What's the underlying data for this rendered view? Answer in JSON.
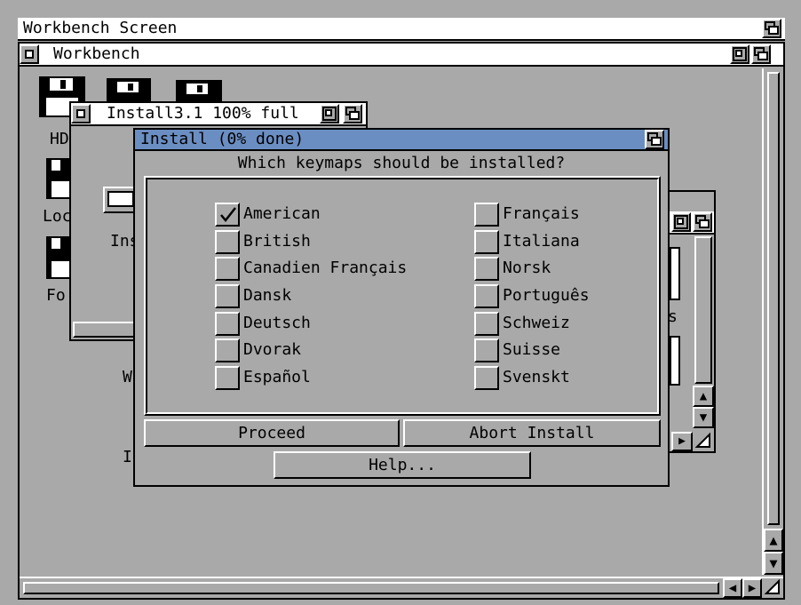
{
  "screen": {
    "title": "Workbench Screen"
  },
  "workbench_window": {
    "title": "Workbench"
  },
  "desktop_icons": [
    "HD",
    "Loc",
    "Fo"
  ],
  "drawer_window": {
    "title": "Install3.1  100% full",
    "icon_label": "Ins"
  },
  "partial_labels": {
    "w": "W",
    "i": "I",
    "s": "s"
  },
  "install_dialog": {
    "title": "Install (0% done)",
    "question": "Which keymaps should be installed?",
    "options_left": [
      {
        "label": "American",
        "checked": true
      },
      {
        "label": "British",
        "checked": false
      },
      {
        "label": "Canadien Français",
        "checked": false
      },
      {
        "label": "Dansk",
        "checked": false
      },
      {
        "label": "Deutsch",
        "checked": false
      },
      {
        "label": "Dvorak",
        "checked": false
      },
      {
        "label": "Español",
        "checked": false
      }
    ],
    "options_right": [
      {
        "label": "Français",
        "checked": false
      },
      {
        "label": "Italiana",
        "checked": false
      },
      {
        "label": "Norsk",
        "checked": false
      },
      {
        "label": "Português",
        "checked": false
      },
      {
        "label": "Schweiz",
        "checked": false
      },
      {
        "label": "Suisse",
        "checked": false
      },
      {
        "label": "Svenskt",
        "checked": false
      }
    ],
    "buttons": {
      "proceed": "Proceed",
      "abort": "Abort Install",
      "help": "Help..."
    }
  },
  "colors": {
    "background": "#a9a9a9",
    "active_title": "#6b8ec2",
    "white": "#ffffff",
    "black": "#000000"
  }
}
